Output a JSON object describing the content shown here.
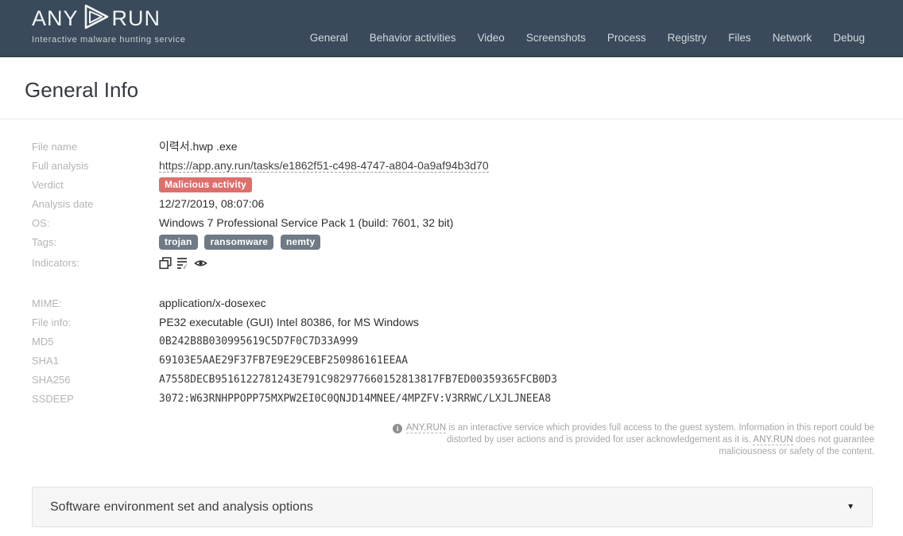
{
  "header": {
    "logo": {
      "word_left": "ANY",
      "word_right": "RUN",
      "subtitle": "Interactive malware hunting service",
      "play_icon": "play-logo-icon"
    },
    "nav": [
      {
        "label": "General"
      },
      {
        "label": "Behavior activities"
      },
      {
        "label": "Video"
      },
      {
        "label": "Screenshots"
      },
      {
        "label": "Process"
      },
      {
        "label": "Registry"
      },
      {
        "label": "Files"
      },
      {
        "label": "Network"
      },
      {
        "label": "Debug"
      }
    ]
  },
  "page": {
    "title": "General Info"
  },
  "info": {
    "rows": [
      {
        "label": "File name",
        "value": "이력서.hwp .exe"
      },
      {
        "label": "Full analysis",
        "value": "https://app.any.run/tasks/e1862f51-c498-4747-a804-0a9af94b3d70"
      },
      {
        "label": "Verdict",
        "value": "Malicious activity"
      },
      {
        "label": "Analysis date",
        "value": "12/27/2019, 08:07:06"
      },
      {
        "label": "OS:",
        "value": "Windows 7 Professional Service Pack 1 (build: 7601, 32 bit)"
      },
      {
        "label": "Tags:",
        "tags": [
          "trojan",
          "ransomware",
          "nemty"
        ]
      },
      {
        "label": "Indicators:",
        "icons": [
          "windows-restore-icon",
          "document-edit-icon",
          "eye-icon"
        ]
      },
      {
        "label": "MIME:",
        "value": "application/x-dosexec"
      },
      {
        "label": "File info:",
        "value": "PE32 executable (GUI) Intel 80386, for MS Windows"
      },
      {
        "label": "MD5",
        "value": "0B242B8B030995619C5D7F0C7D33A999"
      },
      {
        "label": "SHA1",
        "value": "69103E5AAE29F37FB7E9E29CEBF250986161EEAA"
      },
      {
        "label": "SHA256",
        "value": "A7558DECB9516122781243E791C982977660152813817FB7ED00359365FCB0D3"
      },
      {
        "label": "SSDEEP",
        "value": "3072:W63RNHPPOPP75MXPW2EI0C0QNJD14MNEE/4MPZFV:V3RRWC/LXJLJNEEA8"
      }
    ]
  },
  "disclaimer": {
    "brand1": "ANY.RUN",
    "text1": " is an interactive service which provides full access to the guest system. Information in this report could be distorted by user actions and is provided for user acknowledgement as it is. ",
    "brand2": "ANY.RUN",
    "text2": " does not guarantee maliciousness or safety of the content."
  },
  "panel": {
    "title": "Software environment set and analysis options",
    "chevron": "▼"
  },
  "colors": {
    "header_bg": "#3a4a5a",
    "danger_badge": "#dd6f6c",
    "tag_badge": "#6f7a86",
    "label_text": "#b4b4b4",
    "value_text": "#2e2e2e"
  }
}
